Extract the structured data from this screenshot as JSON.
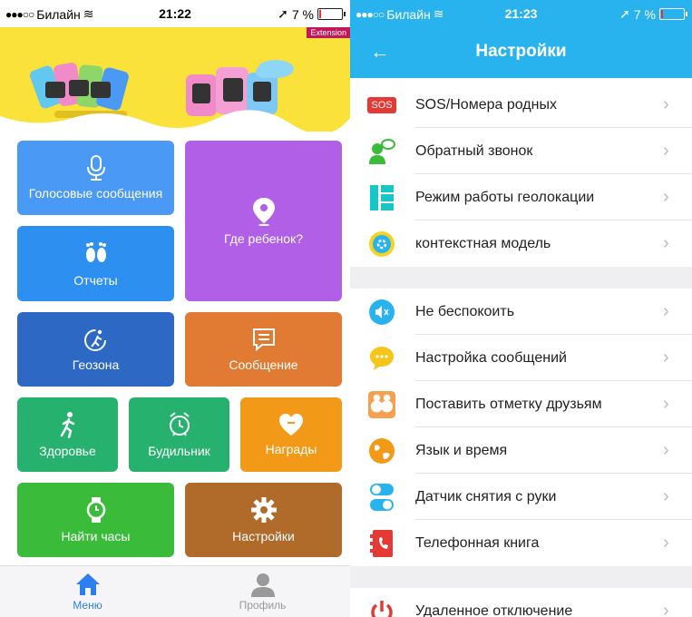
{
  "left": {
    "status": {
      "carrier": "Билайн",
      "time": "21:22",
      "battery": "7 %"
    },
    "banner": {
      "badge": "Extension"
    },
    "tiles": {
      "voice": "Голосовые сообщения",
      "where": "Где ребенок?",
      "reports": "Отчеты",
      "geozone": "Геозона",
      "message": "Сообщение",
      "health": "Здоровье",
      "alarm": "Будильник",
      "rewards": "Награды",
      "find": "Найти часы",
      "settings": "Настройки"
    },
    "tabbar": {
      "menu": "Меню",
      "profile": "Профиль"
    },
    "colors": {
      "voice": "#4a9af5",
      "where": "#b05fe6",
      "reports": "#2d8ff0",
      "geozone": "#2d68c4",
      "message": "#e17b33",
      "health": "#26b26e",
      "alarm": "#26b26e",
      "rewards": "#f29a17",
      "find": "#3bbb3a",
      "settings": "#b06a2a",
      "active_tab": "#2d7ff0"
    }
  },
  "right": {
    "status": {
      "carrier": "Билайн",
      "time": "21:23",
      "battery": "7 %"
    },
    "title": "Настройки",
    "section1": [
      {
        "label": "SOS/Номера родных",
        "icon": "sos-icon"
      },
      {
        "label": "Обратный звонок",
        "icon": "callback-icon"
      },
      {
        "label": "Режим работы геолокации",
        "icon": "geolocation-mode-icon"
      },
      {
        "label": "контекстная модель",
        "icon": "context-model-icon"
      }
    ],
    "section2": [
      {
        "label": "Не беспокоить",
        "icon": "mute-icon"
      },
      {
        "label": "Настройка сообщений",
        "icon": "message-settings-icon"
      },
      {
        "label": "Поставить отметку друзьям",
        "icon": "friends-icon"
      },
      {
        "label": "Язык и время",
        "icon": "language-time-icon"
      },
      {
        "label": "Датчик снятия с руки",
        "icon": "wrist-sensor-icon"
      },
      {
        "label": "Телефонная книга",
        "icon": "phonebook-icon"
      }
    ],
    "section3": [
      {
        "label": "Удаленное отключение",
        "icon": "power-icon"
      }
    ],
    "sos_badge": "SOS",
    "navbar_color": "#29b3ee"
  }
}
